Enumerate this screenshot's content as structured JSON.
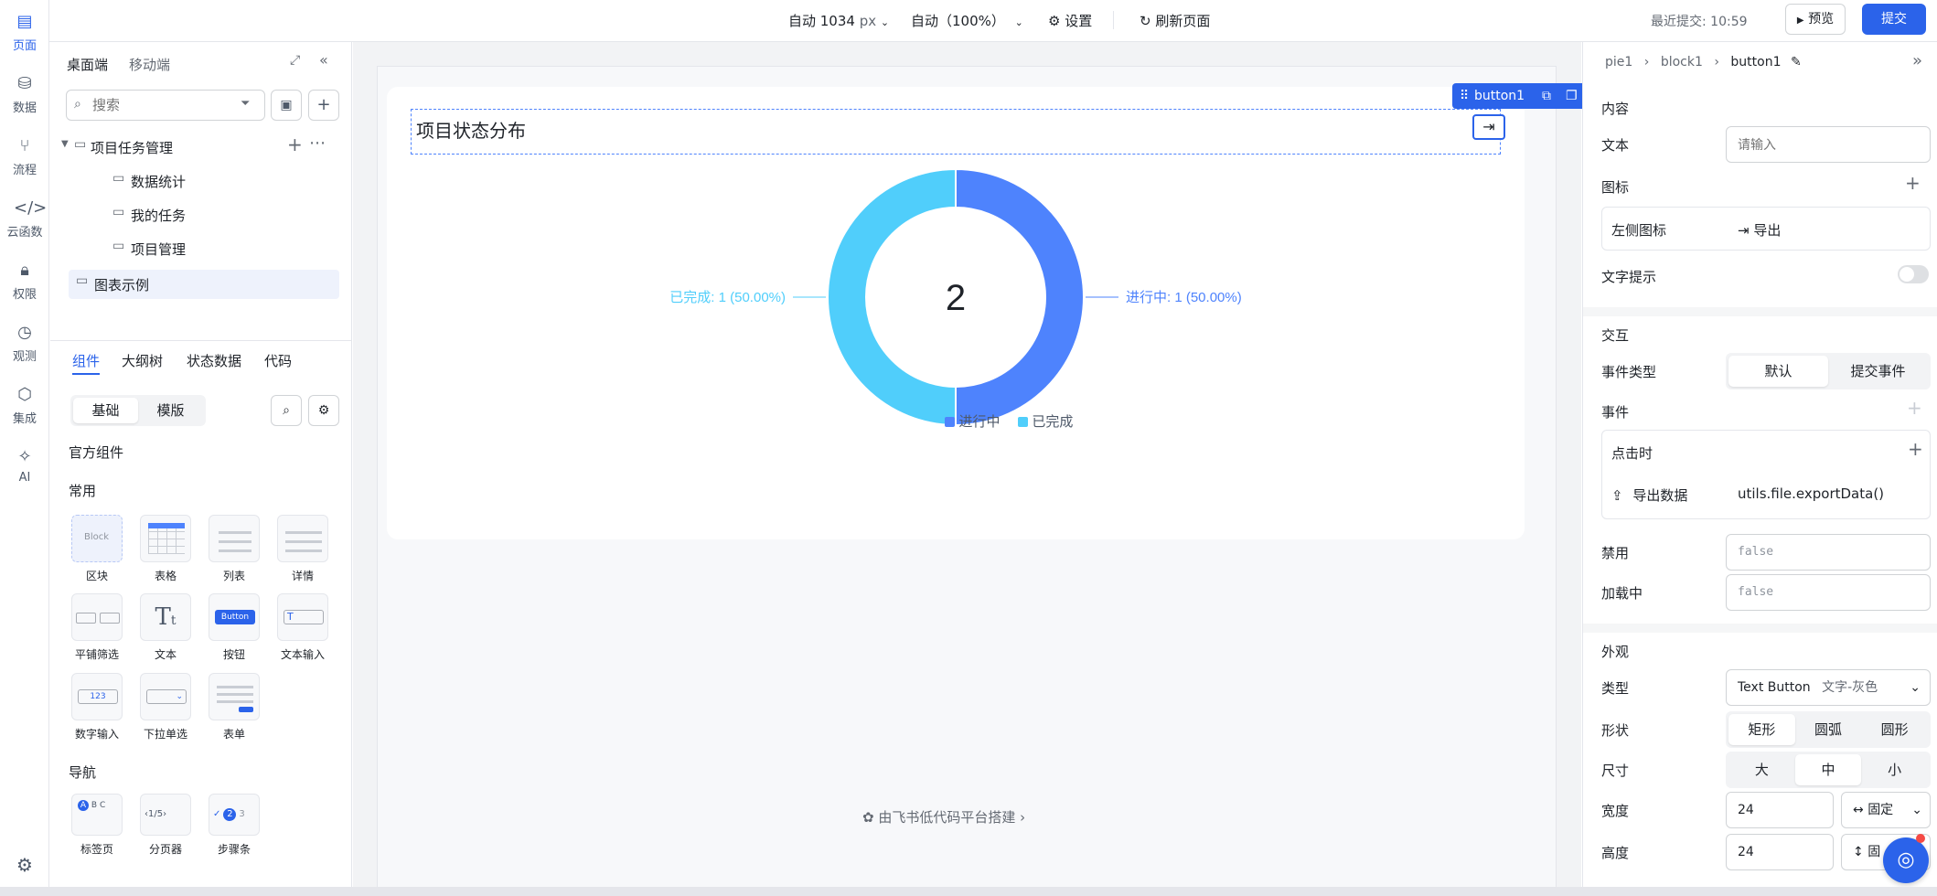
{
  "nav": {
    "items": [
      {
        "label": "页面",
        "icon": "pages-icon"
      },
      {
        "label": "数据",
        "icon": "database-icon"
      },
      {
        "label": "流程",
        "icon": "flow-icon"
      },
      {
        "label": "云函数",
        "icon": "code-icon"
      },
      {
        "label": "权限",
        "icon": "lock-icon"
      },
      {
        "label": "观测",
        "icon": "clock-icon"
      },
      {
        "label": "集成",
        "icon": "cube-icon"
      },
      {
        "label": "AI",
        "icon": "sparkle-icon"
      }
    ]
  },
  "topbar": {
    "width_label": "自动 1034",
    "width_unit": "px",
    "zoom_label": "自动（100%）",
    "settings_label": "设置",
    "refresh_label": "刷新页面",
    "last_submit": "最近提交: 10:59",
    "preview_label": "预览",
    "submit_label": "提交"
  },
  "left": {
    "device_tabs": [
      "桌面端",
      "移动端"
    ],
    "search_placeholder": "搜索",
    "tree_root": "项目任务管理",
    "tree_children": [
      "数据统计",
      "我的任务",
      "项目管理"
    ],
    "tree_selected": "图表示例",
    "panel_tabs": [
      "组件",
      "大纲树",
      "状态数据",
      "代码"
    ],
    "sub_tabs": [
      "基础",
      "模版"
    ],
    "official_title": "官方组件",
    "common_title": "常用",
    "common_items": [
      "区块",
      "表格",
      "列表",
      "详情",
      "平铺筛选",
      "文本",
      "按钮",
      "文本输入",
      "数字输入",
      "下拉单选",
      "表单"
    ],
    "block_thumb": "Block",
    "button_thumb": "Button",
    "number_thumb": "123",
    "nav_title": "导航",
    "nav_items": [
      "标签页",
      "分页器",
      "步骤条"
    ],
    "tabs_thumb": [
      "A",
      "B",
      "C"
    ],
    "pager_thumb": [
      "1",
      "5"
    ],
    "steps_thumb": [
      "2",
      "3"
    ]
  },
  "canvas": {
    "selection_label": "button1",
    "card_title": "项目状态分布",
    "center_value": "2",
    "label_left": "已完成: 1 (50.00%)",
    "label_right": "进行中: 1 (50.00%)",
    "footer": "由飞书低代码平台搭建"
  },
  "chart_data": {
    "type": "pie",
    "donut": true,
    "title": "项目状态分布",
    "center_text": "2",
    "categories": [
      "进行中",
      "已完成"
    ],
    "values": [
      1,
      1
    ],
    "percents": [
      50.0,
      50.0
    ],
    "colors": [
      "#4e83fd",
      "#50cefb"
    ],
    "legend_position": "bottom"
  },
  "right": {
    "breadcrumb": [
      "pie1",
      "block1",
      "button1"
    ],
    "content_title": "内容",
    "text_label": "文本",
    "text_placeholder": "请输入",
    "icon_label": "图标",
    "left_icon_label": "左侧图标",
    "left_icon_value": "导出",
    "tooltip_label": "文字提示",
    "interaction_title": "交互",
    "event_type_label": "事件类型",
    "event_type_options": [
      "默认",
      "提交事件"
    ],
    "events_label": "事件",
    "on_click_label": "点击时",
    "action_label": "导出数据",
    "action_value": "utils.file.exportData()",
    "disabled_label": "禁用",
    "disabled_value": "false",
    "loading_label": "加载中",
    "loading_value": "false",
    "appearance_title": "外观",
    "type_label": "类型",
    "type_value": "Text Button",
    "type_sub": "文字-灰色",
    "shape_label": "形状",
    "shape_options": [
      "矩形",
      "圆弧",
      "圆形"
    ],
    "size_label": "尺寸",
    "size_options": [
      "大",
      "中",
      "小"
    ],
    "width_label": "宽度",
    "width_value": "24",
    "width_mode": "固定",
    "height_label": "高度",
    "height_value": "24",
    "height_mode": "固"
  }
}
